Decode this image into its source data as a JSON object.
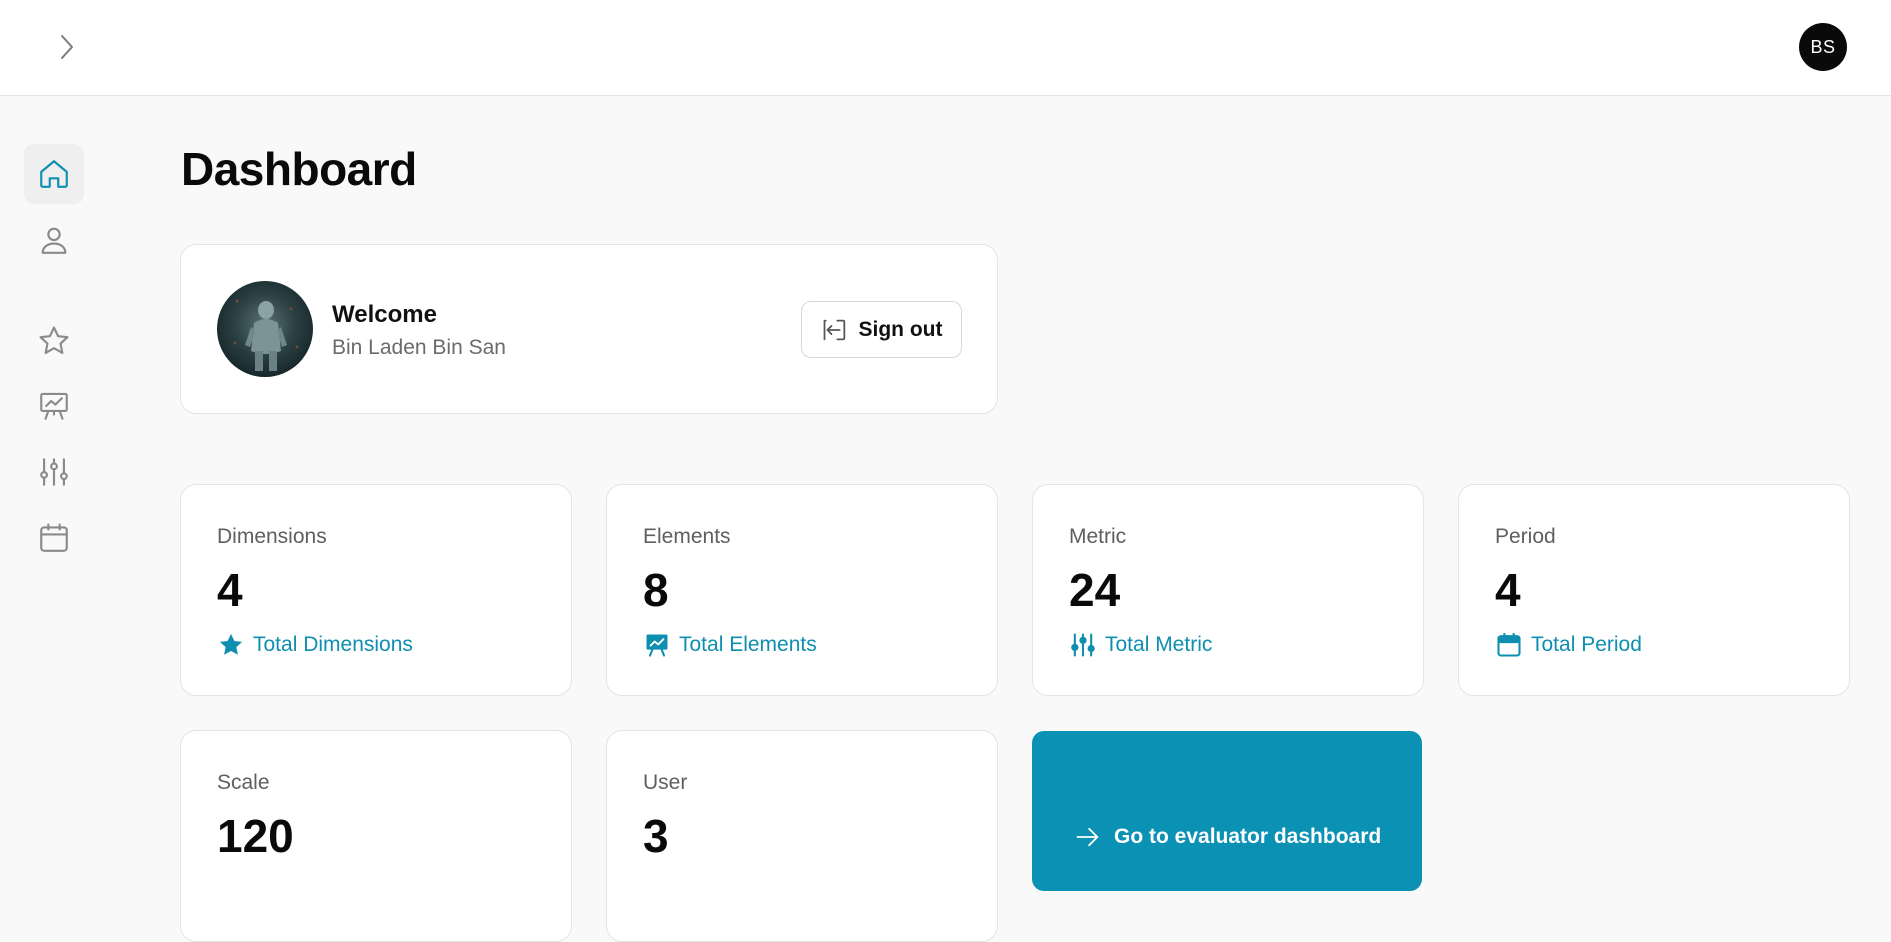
{
  "header": {
    "user_initials": "BS"
  },
  "sidebar": {
    "items": [
      {
        "icon": "home-icon",
        "active": true
      },
      {
        "icon": "user-icon"
      },
      {
        "icon": "star-icon"
      },
      {
        "icon": "presentation-chart-icon"
      },
      {
        "icon": "sliders-icon"
      },
      {
        "icon": "calendar-icon"
      }
    ]
  },
  "main": {
    "title": "Dashboard",
    "welcome": {
      "title": "Welcome",
      "name": "Bin Laden Bin San",
      "signout_label": "Sign out"
    },
    "stats": [
      {
        "label": "Dimensions",
        "value": "4",
        "footer": "Total Dimensions",
        "icon": "star-icon"
      },
      {
        "label": "Elements",
        "value": "8",
        "footer": "Total Elements",
        "icon": "presentation-chart-icon"
      },
      {
        "label": "Metric",
        "value": "24",
        "footer": "Total Metric",
        "icon": "sliders-icon"
      },
      {
        "label": "Period",
        "value": "4",
        "footer": "Total Period",
        "icon": "calendar-icon"
      },
      {
        "label": "Scale",
        "value": "120"
      },
      {
        "label": "User",
        "value": "3"
      }
    ],
    "cta": {
      "label": "Go to evaluator dashboard",
      "icon": "arrow-right-icon"
    }
  },
  "colors": {
    "accent": "#0e8fb0",
    "cta_background": "#0a91b4",
    "active_nav": "#0e8fb0",
    "inactive_nav": "#8a8a8a"
  }
}
